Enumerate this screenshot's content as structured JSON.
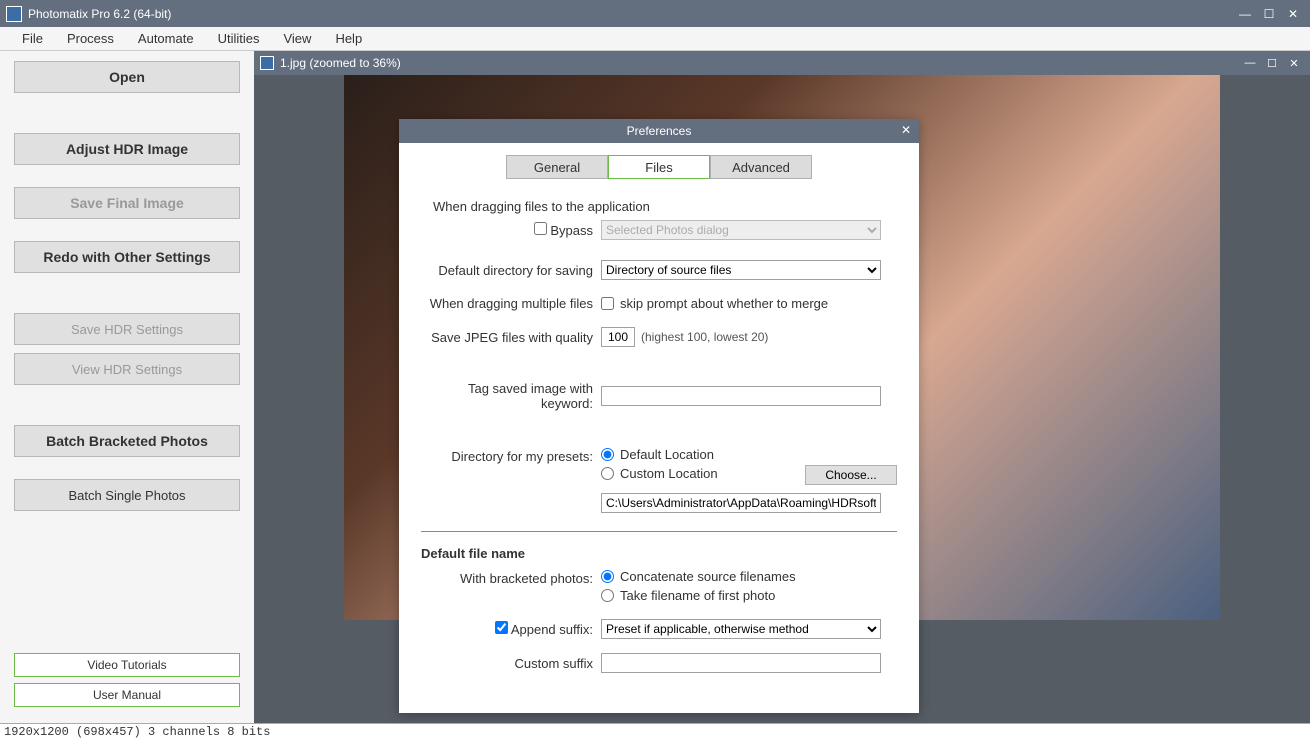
{
  "app": {
    "title": "Photomatix Pro 6.2 (64-bit)"
  },
  "menu": {
    "file": "File",
    "process": "Process",
    "automate": "Automate",
    "utilities": "Utilities",
    "view": "View",
    "help": "Help"
  },
  "sidebar": {
    "open": "Open",
    "adjust": "Adjust HDR Image",
    "save_final": "Save Final Image",
    "redo": "Redo with Other Settings",
    "save_hdr": "Save HDR Settings",
    "view_hdr": "View HDR Settings",
    "batch_bracketed": "Batch Bracketed Photos",
    "batch_single": "Batch Single Photos",
    "tutorials": "Video Tutorials",
    "manual": "User Manual"
  },
  "doc": {
    "title": "1.jpg (zoomed to 36%)"
  },
  "prefs": {
    "title": "Preferences",
    "tabs": {
      "general": "General",
      "files": "Files",
      "advanced": "Advanced"
    },
    "dragging_heading": "When dragging files to the application",
    "bypass_label": "Bypass",
    "bypass_dropdown": "Selected Photos dialog",
    "default_dir_label": "Default directory for saving",
    "default_dir_value": "Directory of source files",
    "multi_label": "When dragging multiple files",
    "skip_prompt": "skip prompt about whether to merge",
    "jpeg_label": "Save JPEG files with quality",
    "jpeg_value": "100",
    "jpeg_hint": "(highest 100, lowest 20)",
    "tag_label": "Tag saved image with keyword:",
    "tag_value": "",
    "presets_label": "Directory for my presets:",
    "presets_default": "Default Location",
    "presets_custom": "Custom Location",
    "choose": "Choose...",
    "presets_path": "C:\\Users\\Administrator\\AppData\\Roaming\\HDRsoft\\Photon",
    "filename_heading": "Default file name",
    "bracketed_label": "With bracketed photos:",
    "concat": "Concatenate source filenames",
    "take_first": "Take filename of first photo",
    "append_suffix": "Append suffix:",
    "suffix_dropdown": "Preset if applicable, otherwise method",
    "custom_suffix_label": "Custom suffix",
    "custom_suffix_value": ""
  },
  "statusbar": "1920x1200 (698x457) 3 channels 8 bits"
}
